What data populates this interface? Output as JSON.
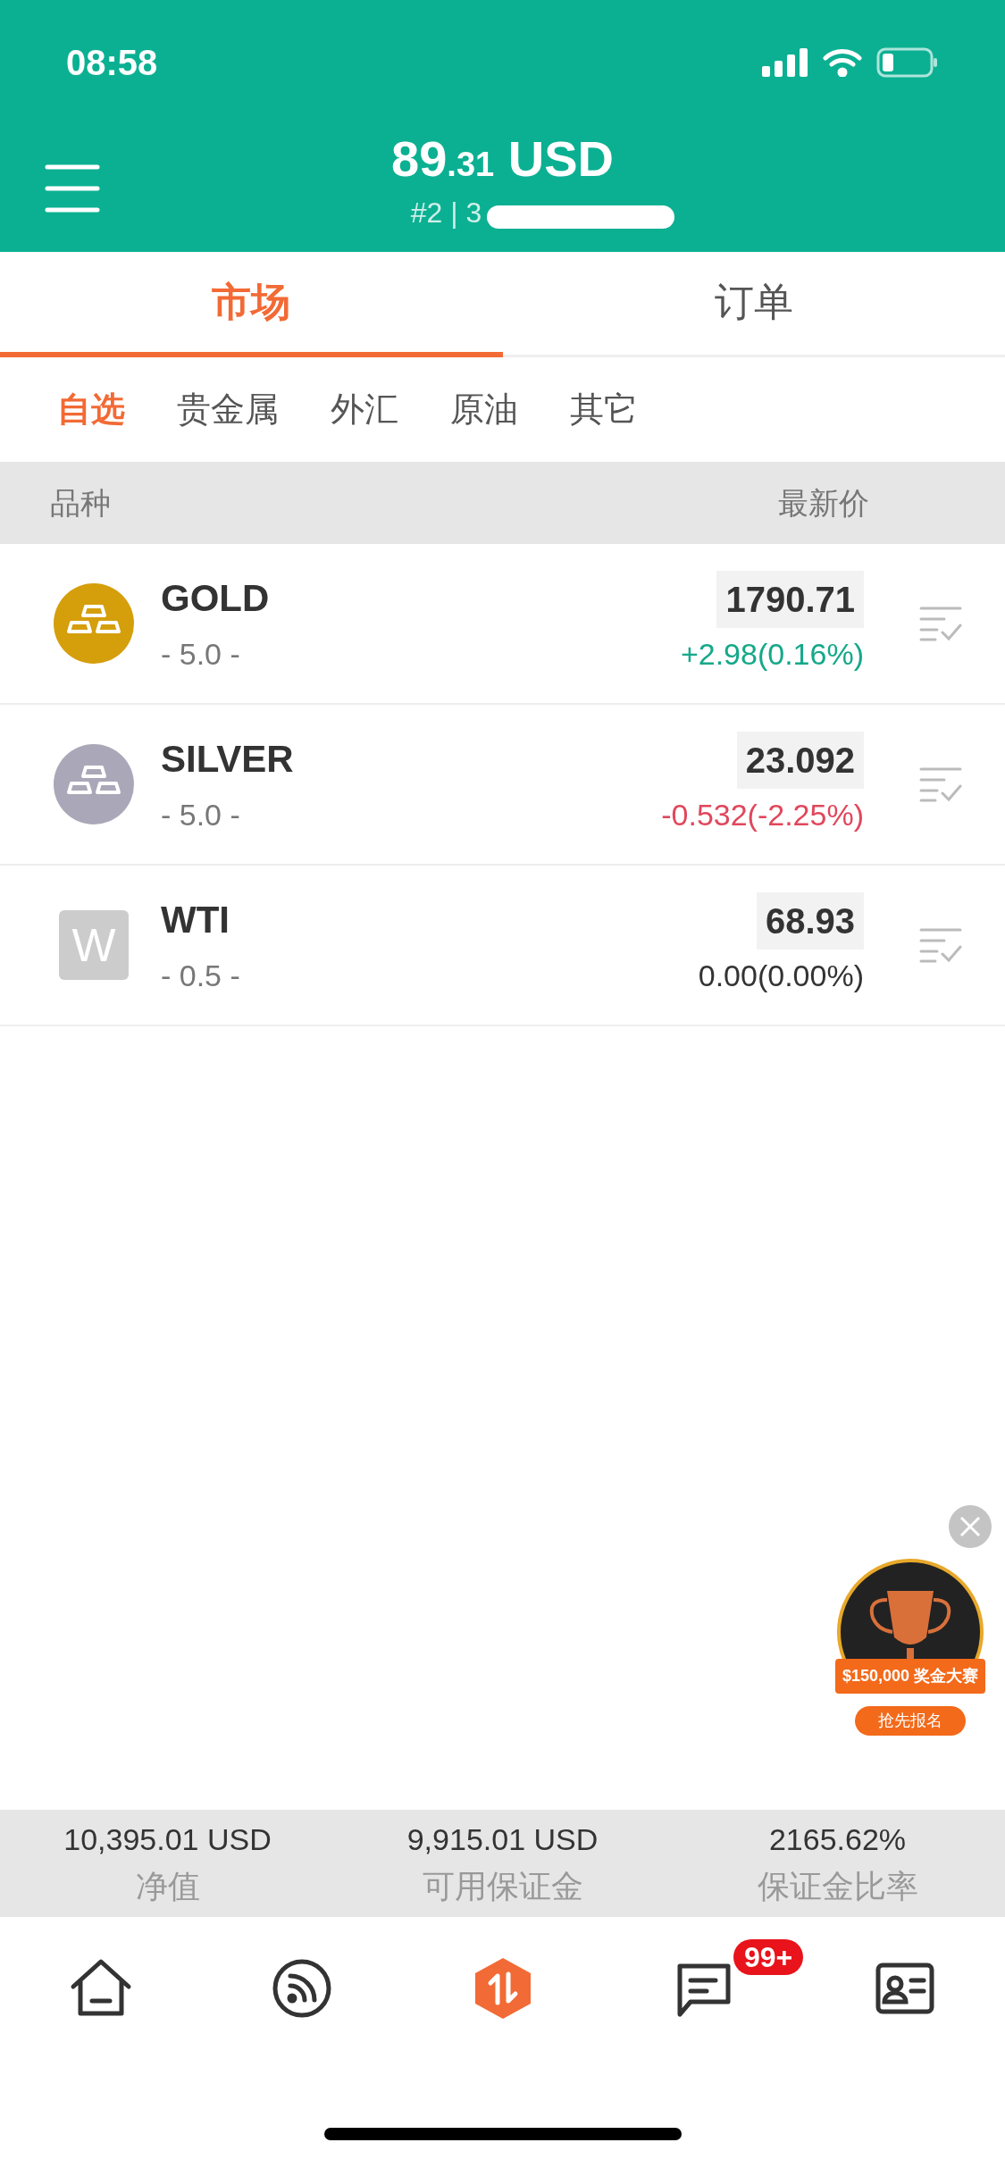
{
  "status_bar": {
    "time": "08:58"
  },
  "header": {
    "balance_integer": "89",
    "balance_decimal": ".31",
    "balance_unit": "USD",
    "account": "#2 | 3"
  },
  "tabs": [
    {
      "label": "市场",
      "selected": true
    },
    {
      "label": "订单",
      "selected": false
    }
  ],
  "categories": [
    {
      "label": "自选",
      "selected": true
    },
    {
      "label": "贵金属",
      "selected": false
    },
    {
      "label": "外汇",
      "selected": false
    },
    {
      "label": "原油",
      "selected": false
    },
    {
      "label": "其它",
      "selected": false
    }
  ],
  "table": {
    "columns": [
      "品种",
      "最新价"
    ],
    "rows": [
      {
        "icon": {
          "kind": "bars",
          "color": "#d59e0b"
        },
        "name": "GOLD",
        "lot": "- 5.0 -",
        "price": "1790.71",
        "change": "+2.98(0.16%)",
        "color": "#15a88a"
      },
      {
        "icon": {
          "kind": "bars",
          "color": "#aaa8b8"
        },
        "name": "SILVER",
        "lot": "- 5.0 -",
        "price": "23.092",
        "change": "-0.532(-2.25%)",
        "color": "#e0475c"
      },
      {
        "icon": {
          "kind": "letter",
          "letter": "W"
        },
        "name": "WTI",
        "lot": "- 0.5 -",
        "price": "68.93",
        "change": "0.00(0.00%)",
        "color": "#333333"
      }
    ]
  },
  "promo": {
    "banner": "$150,000 奖金大赛",
    "button": "抢先报名"
  },
  "summary": [
    {
      "value": "10,395.01 USD",
      "label": "净值"
    },
    {
      "value": "9,915.01 USD",
      "label": "可用保证金"
    },
    {
      "value": "2165.62%",
      "label": "保证金比率"
    }
  ],
  "nav": [
    {
      "kind": "home",
      "selected": false
    },
    {
      "kind": "feed",
      "selected": false
    },
    {
      "kind": "trade",
      "selected": true
    },
    {
      "kind": "messages",
      "selected": false,
      "badge": "99+"
    },
    {
      "kind": "profile",
      "selected": false
    }
  ]
}
